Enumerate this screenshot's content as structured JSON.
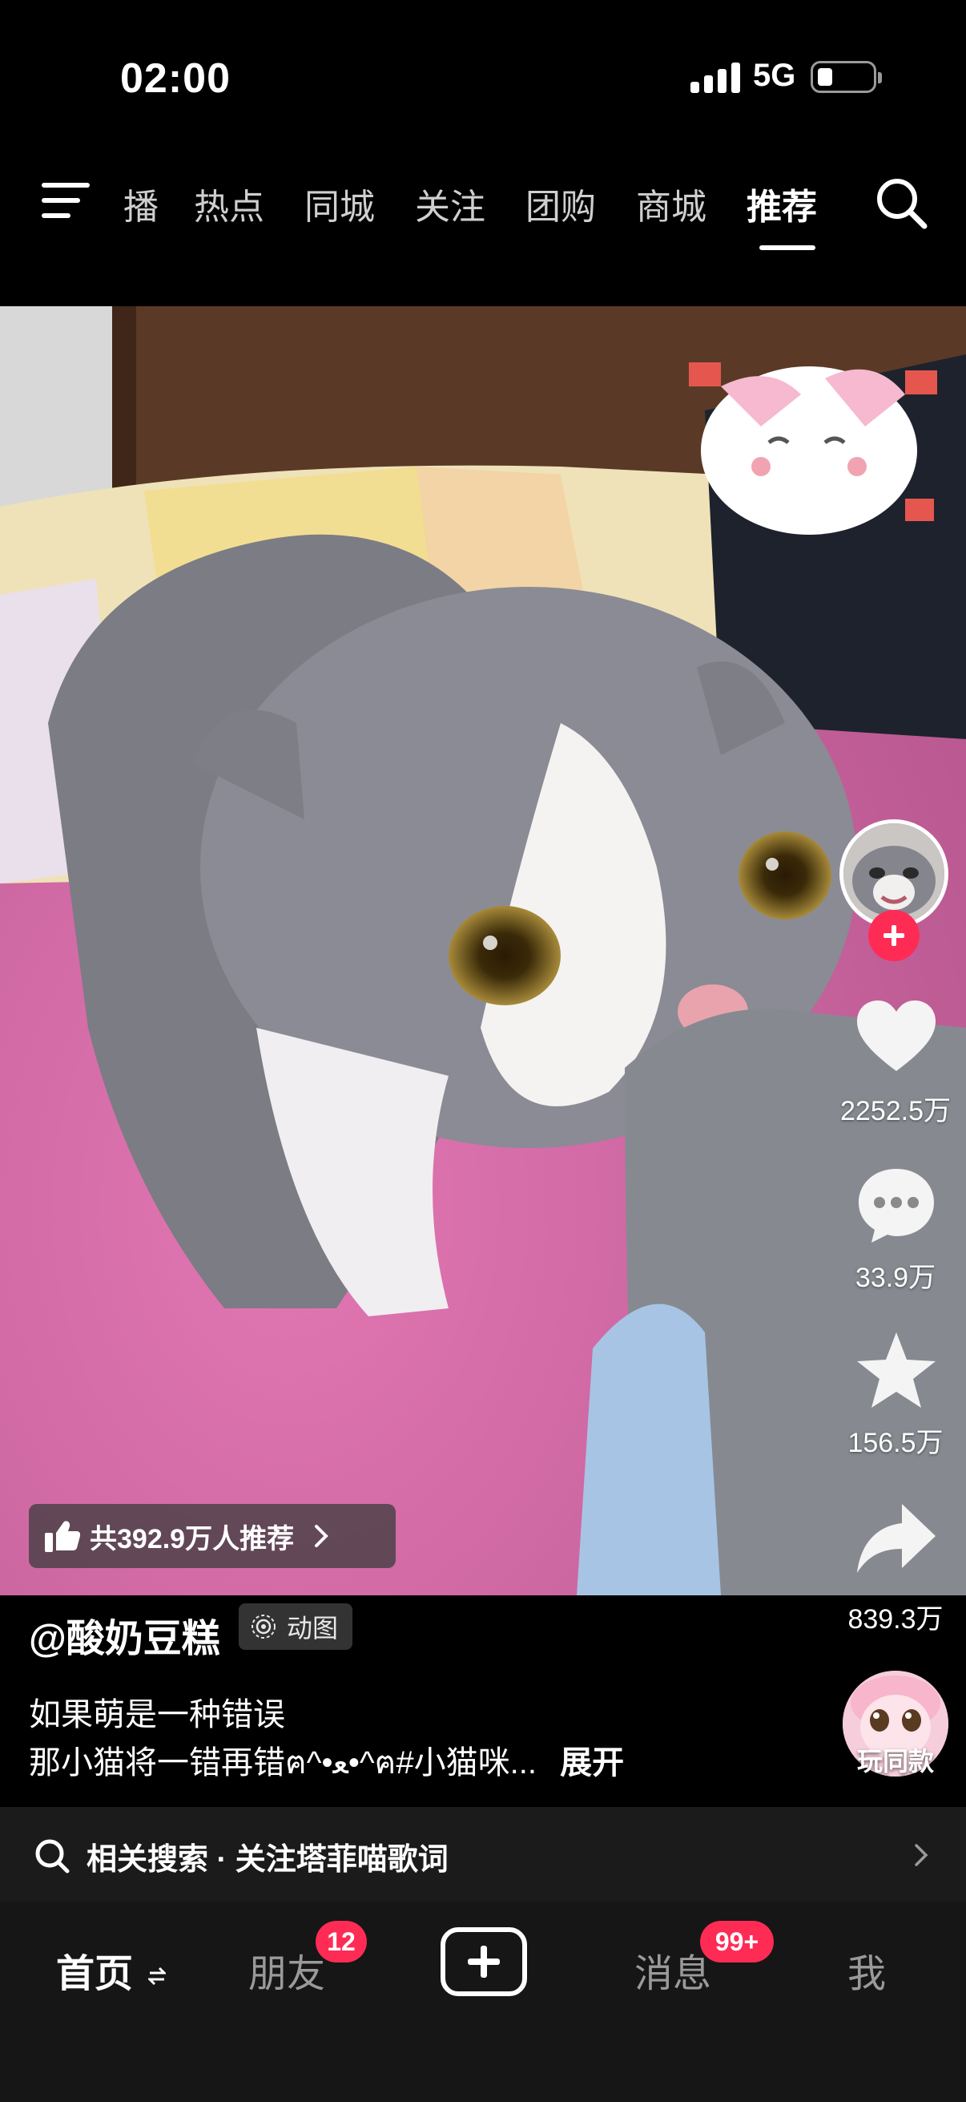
{
  "status_bar": {
    "time": "02:00",
    "network": "5G"
  },
  "top_nav": {
    "tabs": [
      "播",
      "热点",
      "同城",
      "关注",
      "团购",
      "商城",
      "推荐"
    ],
    "active_tab": "推荐"
  },
  "video": {
    "author": "@酸奶豆糕",
    "badge": "动图",
    "caption_line1": "如果萌是一种错误",
    "caption_line2": "那小猫将一错再错ฅ^•ﻌ•^ฅ#小猫咪...",
    "expand": "展开",
    "recommend": "共392.9万人推荐",
    "same_style": "玩同款"
  },
  "rail": {
    "likes": "2252.5万",
    "comments": "33.9万",
    "favorites": "156.5万",
    "shares": "839.3万"
  },
  "related_search": {
    "text": "相关搜索 · 关注塔菲喵歌词"
  },
  "bottom_nav": {
    "home": "首页",
    "friends": "朋友",
    "friends_badge": "12",
    "messages": "消息",
    "messages_badge": "99+",
    "me": "我"
  },
  "colors": {
    "accent": "#fe2c55",
    "bar_bg": "#161616"
  },
  "icons": [
    "menu-icon",
    "search-icon",
    "heart-icon",
    "comment-icon",
    "star-icon",
    "share-icon",
    "thumbs-up-icon",
    "chevron-right-icon",
    "plus-icon",
    "swap-icon"
  ]
}
